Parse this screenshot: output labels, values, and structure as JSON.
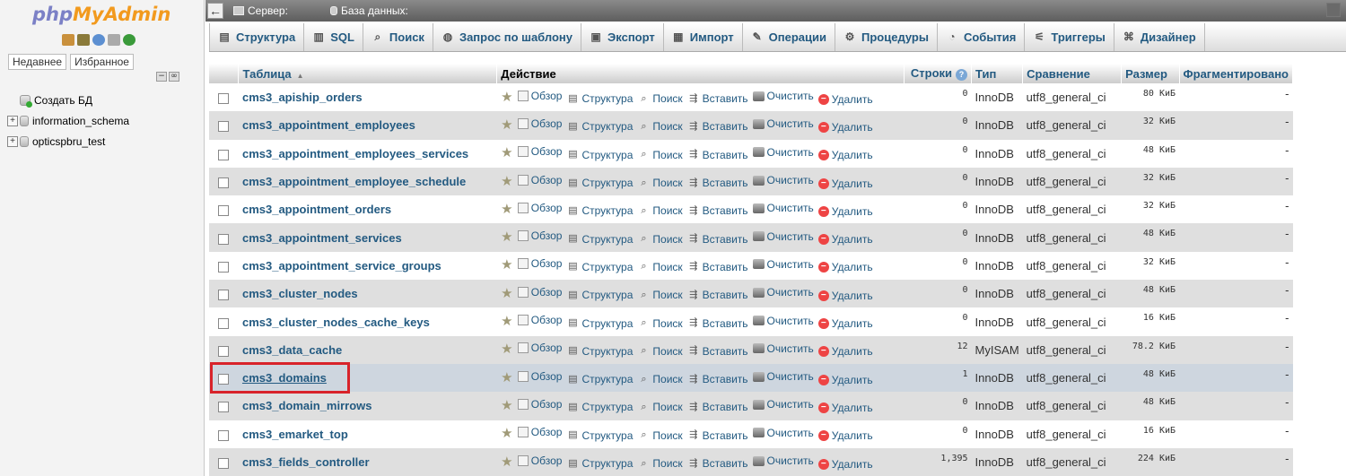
{
  "sidebar": {
    "logo_php": "php",
    "logo_my": "My",
    "logo_admin": "Admin",
    "tab_recent": "Недавнее",
    "tab_favorites": "Избранное",
    "tree": [
      {
        "label": "Создать БД",
        "kind": "new"
      },
      {
        "label": "information_schema",
        "kind": "db"
      },
      {
        "label": "opticspbru_test",
        "kind": "db"
      }
    ]
  },
  "topbar": {
    "server_label": "Сервер:",
    "database_label": "База данных:"
  },
  "tabs": [
    {
      "label": "Структура",
      "icon": "structure-icon"
    },
    {
      "label": "SQL",
      "icon": "sql-icon"
    },
    {
      "label": "Поиск",
      "icon": "search-icon"
    },
    {
      "label": "Запрос по шаблону",
      "icon": "query-icon"
    },
    {
      "label": "Экспорт",
      "icon": "export-icon"
    },
    {
      "label": "Импорт",
      "icon": "import-icon"
    },
    {
      "label": "Операции",
      "icon": "operations-icon"
    },
    {
      "label": "Процедуры",
      "icon": "routines-icon"
    },
    {
      "label": "События",
      "icon": "events-icon"
    },
    {
      "label": "Триггеры",
      "icon": "triggers-icon"
    },
    {
      "label": "Дизайнер",
      "icon": "designer-icon"
    }
  ],
  "table": {
    "headers": {
      "table": "Таблица",
      "action": "Действие",
      "rows": "Строки",
      "type": "Тип",
      "collation": "Сравнение",
      "size": "Размер",
      "overhead": "Фрагментировано"
    },
    "actions": {
      "browse": "Обзор",
      "structure": "Структура",
      "search": "Поиск",
      "insert": "Вставить",
      "empty": "Очистить",
      "drop": "Удалить"
    },
    "rows": [
      {
        "name": "cms3_apiship_orders",
        "rows": "0",
        "type": "InnoDB",
        "collation": "utf8_general_ci",
        "size": "80 КиБ",
        "overhead": "-"
      },
      {
        "name": "cms3_appointment_employees",
        "rows": "0",
        "type": "InnoDB",
        "collation": "utf8_general_ci",
        "size": "32 КиБ",
        "overhead": "-"
      },
      {
        "name": "cms3_appointment_employees_services",
        "rows": "0",
        "type": "InnoDB",
        "collation": "utf8_general_ci",
        "size": "48 КиБ",
        "overhead": "-"
      },
      {
        "name": "cms3_appointment_employee_schedule",
        "rows": "0",
        "type": "InnoDB",
        "collation": "utf8_general_ci",
        "size": "32 КиБ",
        "overhead": "-"
      },
      {
        "name": "cms3_appointment_orders",
        "rows": "0",
        "type": "InnoDB",
        "collation": "utf8_general_ci",
        "size": "32 КиБ",
        "overhead": "-"
      },
      {
        "name": "cms3_appointment_services",
        "rows": "0",
        "type": "InnoDB",
        "collation": "utf8_general_ci",
        "size": "48 КиБ",
        "overhead": "-"
      },
      {
        "name": "cms3_appointment_service_groups",
        "rows": "0",
        "type": "InnoDB",
        "collation": "utf8_general_ci",
        "size": "32 КиБ",
        "overhead": "-"
      },
      {
        "name": "cms3_cluster_nodes",
        "rows": "0",
        "type": "InnoDB",
        "collation": "utf8_general_ci",
        "size": "48 КиБ",
        "overhead": "-"
      },
      {
        "name": "cms3_cluster_nodes_cache_keys",
        "rows": "0",
        "type": "InnoDB",
        "collation": "utf8_general_ci",
        "size": "16 КиБ",
        "overhead": "-"
      },
      {
        "name": "cms3_data_cache",
        "rows": "12",
        "type": "MyISAM",
        "collation": "utf8_general_ci",
        "size": "78.2 КиБ",
        "overhead": "-"
      },
      {
        "name": "cms3_domains",
        "rows": "1",
        "type": "InnoDB",
        "collation": "utf8_general_ci",
        "size": "48 КиБ",
        "overhead": "-",
        "marked": true
      },
      {
        "name": "cms3_domain_mirrows",
        "rows": "0",
        "type": "InnoDB",
        "collation": "utf8_general_ci",
        "size": "48 КиБ",
        "overhead": "-"
      },
      {
        "name": "cms3_emarket_top",
        "rows": "0",
        "type": "InnoDB",
        "collation": "utf8_general_ci",
        "size": "16 КиБ",
        "overhead": "-"
      },
      {
        "name": "cms3_fields_controller",
        "rows": "1,395",
        "type": "InnoDB",
        "collation": "utf8_general_ci",
        "size": "224 КиБ",
        "overhead": "-"
      }
    ]
  }
}
